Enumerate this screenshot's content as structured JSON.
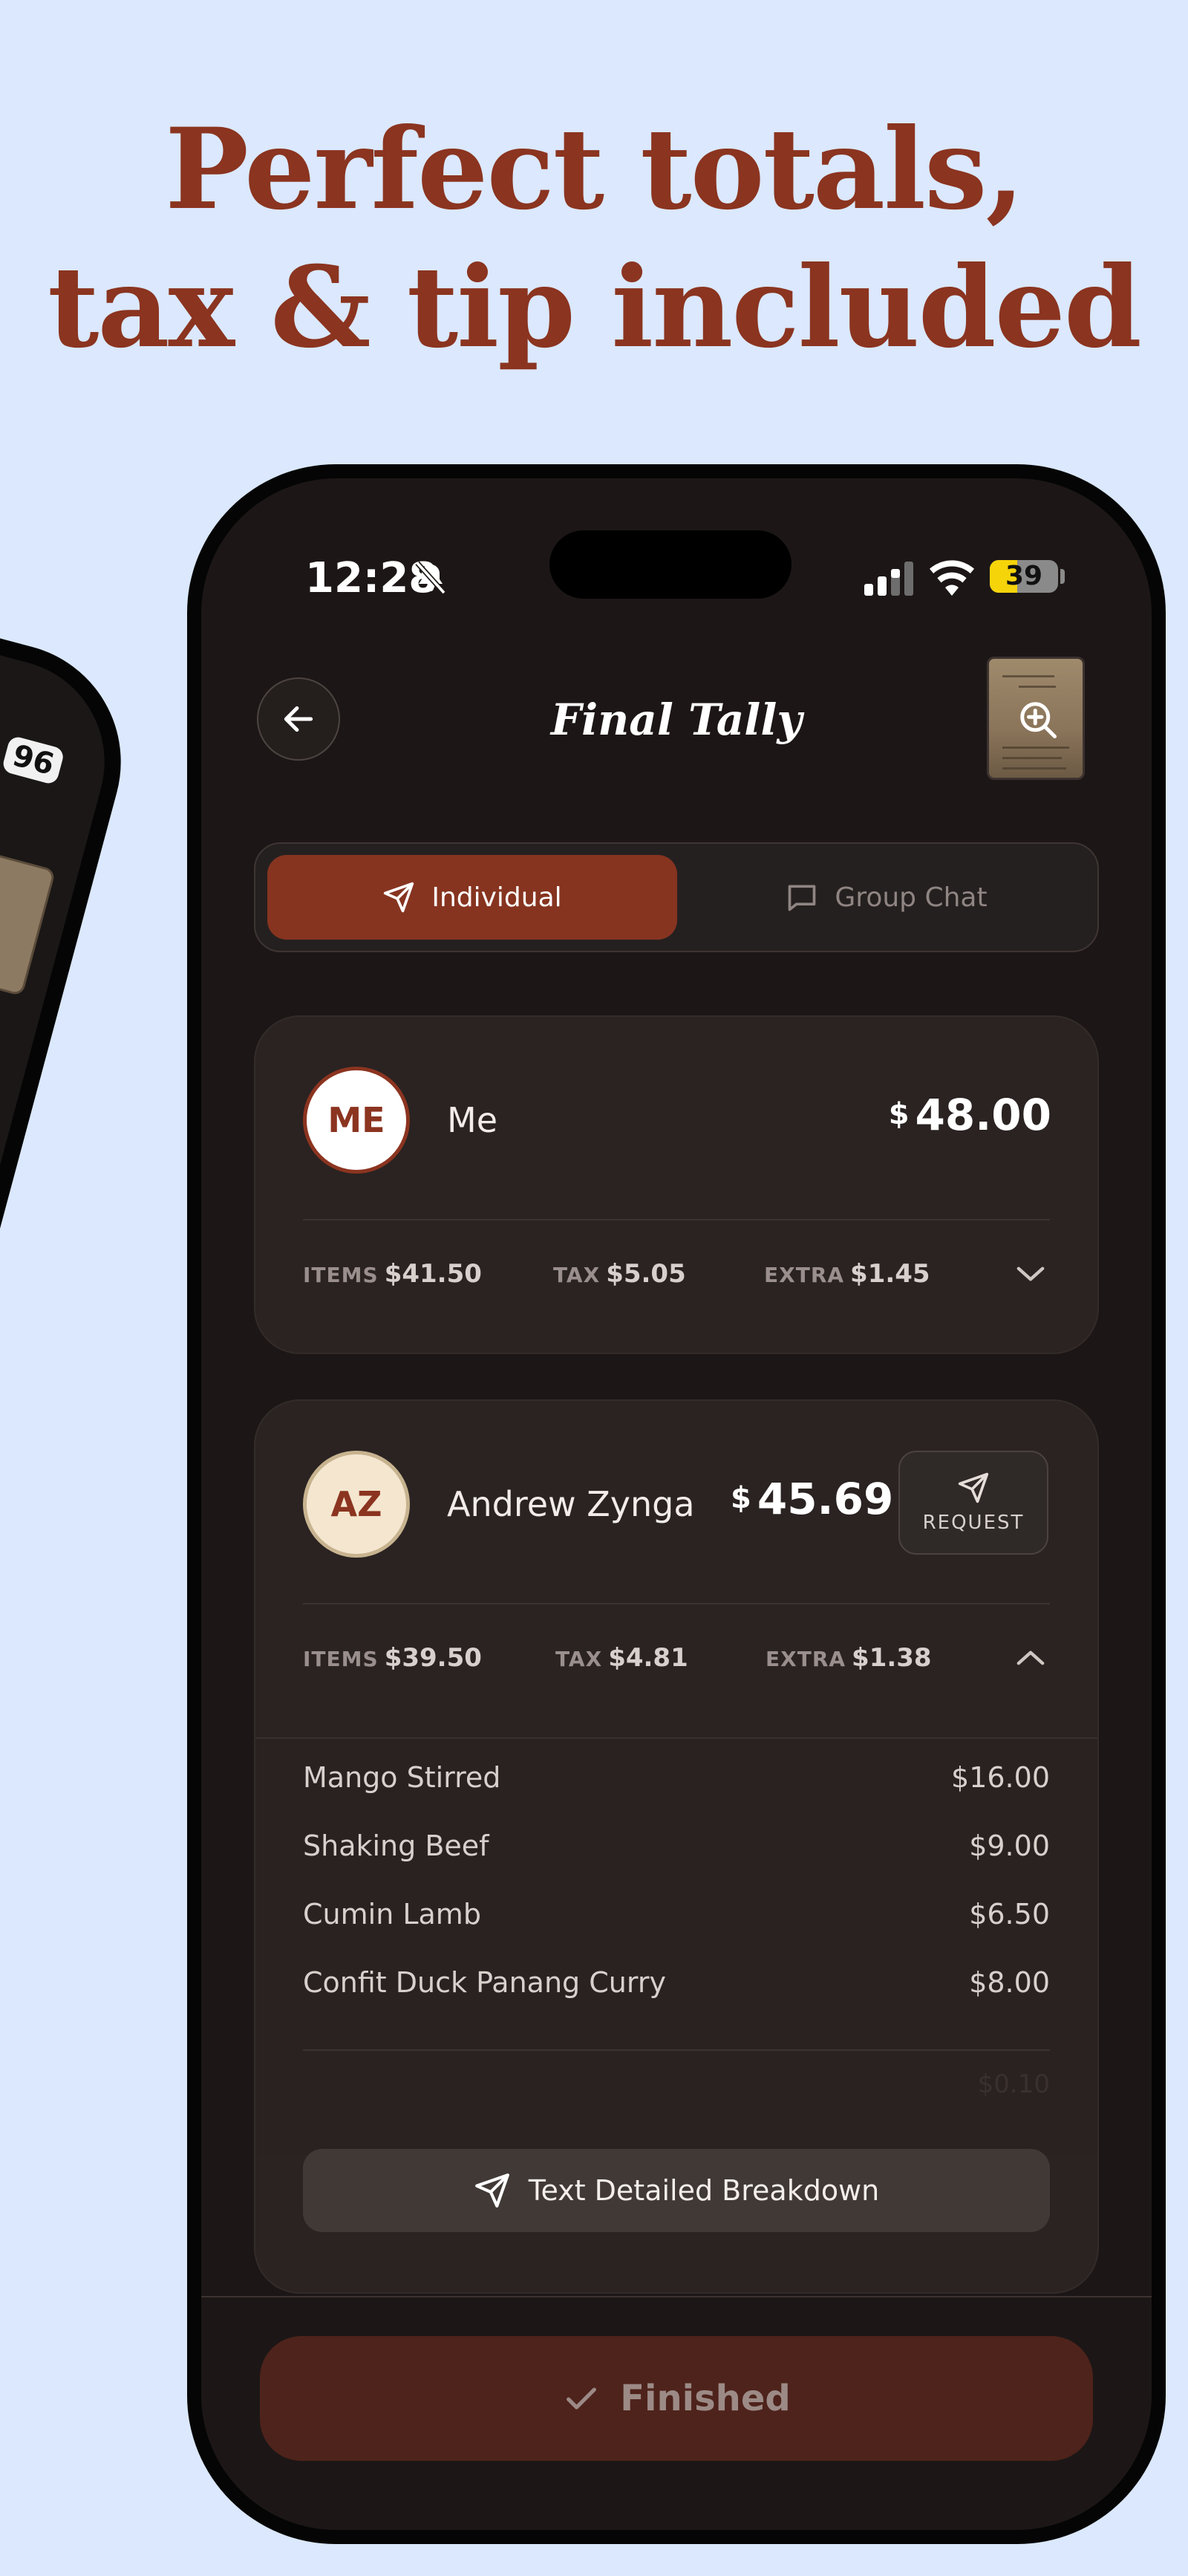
{
  "headline": {
    "line1": "Perfect totals,",
    "line2": "tax & tip included"
  },
  "back_phone": {
    "battery": "96"
  },
  "status_bar": {
    "time": "12:28",
    "battery": "39"
  },
  "header": {
    "title": "Final Tally"
  },
  "segments": {
    "individual": "Individual",
    "group_chat": "Group Chat",
    "selected": "Individual"
  },
  "people": [
    {
      "initials": "ME",
      "name": "Me",
      "currency": "$",
      "total": "48.00",
      "items_label": "ITEMS",
      "items": "$41.50",
      "tax_label": "TAX",
      "tax": "$5.05",
      "extra_label": "EXTRA",
      "extra": "$1.45",
      "expanded": false
    },
    {
      "initials": "AZ",
      "name": "Andrew Zynga",
      "currency": "$",
      "total": "45.69",
      "request_label": "REQUEST",
      "items_label": "ITEMS",
      "items": "$39.50",
      "tax_label": "TAX",
      "tax": "$4.81",
      "extra_label": "EXTRA",
      "extra": "$1.38",
      "expanded": true,
      "line_items": [
        {
          "name": "Mango Stirred",
          "price": "$16.00"
        },
        {
          "name": "Shaking Beef",
          "price": "$9.00"
        },
        {
          "name": "Cumin Lamb",
          "price": "$6.50"
        },
        {
          "name": "Confit Duck Panang Curry",
          "price": "$8.00"
        }
      ],
      "faded_price": "$0.10",
      "breakdown_button": "Text Detailed Breakdown"
    }
  ],
  "footer": {
    "finished_label": "Finished"
  },
  "colors": {
    "background": "#dbe8fd",
    "accent": "#863420",
    "headline": "#8b3420"
  }
}
